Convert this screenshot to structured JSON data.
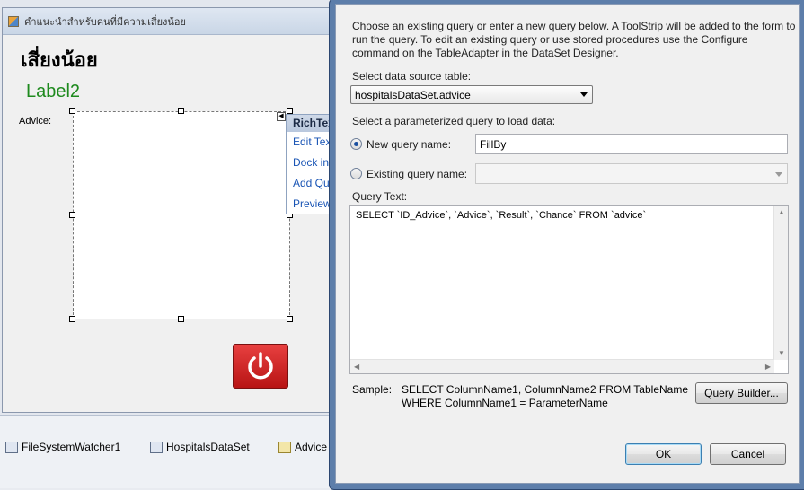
{
  "form": {
    "title": "คำแนะนำสำหรับคนที่มีความเสี่ยงน้อย",
    "heading": "เสี่ยงน้อย",
    "label2": "Label2",
    "advice_label": "Advice:"
  },
  "smart_tag": {
    "header": "RichTex",
    "items": [
      "Edit Tex",
      "Dock in",
      "Add Qu",
      "Preview"
    ]
  },
  "component_tray": {
    "items": [
      {
        "label": "FileSystemWatcher1",
        "icon": "filesystemwatcher-icon"
      },
      {
        "label": "HospitalsDataSet",
        "icon": "dataset-icon"
      },
      {
        "label": "Advice",
        "icon": "tableadapter-icon"
      }
    ]
  },
  "dialog": {
    "intro_text": "Choose an existing query or enter a new query below. A ToolStrip will be added to the form to run the query. To edit an existing query or use stored procedures use the Configure command on the TableAdapter in the DataSet Designer.",
    "datasource_label": "Select data source table:",
    "datasource_value": "hospitalsDataSet.advice",
    "param_query_label": "Select a parameterized query to load data:",
    "new_query_label": "New query name:",
    "new_query_value": "FillBy",
    "existing_query_label": "Existing query name:",
    "existing_query_value": "",
    "selected_option": "new",
    "query_text_label": "Query Text:",
    "query_text": "SELECT `ID_Advice`, `Advice`, `Result`, `Chance` FROM `advice`",
    "sample_label": "Sample:",
    "sample_line1": "SELECT ColumnName1, ColumnName2 FROM TableName",
    "sample_line2": "WHERE ColumnName1 = ParameterName",
    "query_builder_label": "Query Builder...",
    "ok_label": "OK",
    "cancel_label": "Cancel"
  },
  "colors": {
    "label2": "#1e8a1e",
    "power_button": "#d42020",
    "link": "#1a55b5",
    "dialog_frame": "#5d7eaa"
  }
}
